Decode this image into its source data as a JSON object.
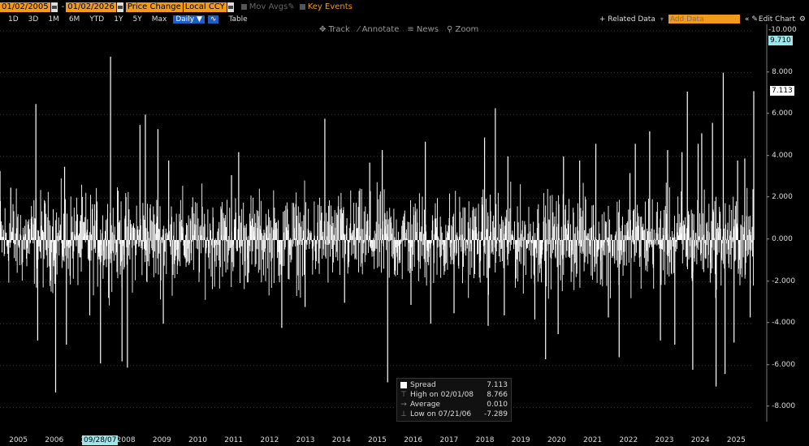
{
  "toolbar": {
    "start_date": "01/02/2005",
    "end_date": "01/02/2026",
    "mode": "Price Change",
    "currency": "Local CCY",
    "mov_avgs": "Mov Avgs",
    "key_events": "Key Events",
    "related_data": "+ Related Data",
    "add_data_placeholder": "Add Data",
    "edit_chart": "Edit Chart"
  },
  "ranges": [
    "1D",
    "3D",
    "1M",
    "6M",
    "YTD",
    "1Y",
    "5Y",
    "Max"
  ],
  "frequency": "Daily ▼",
  "table_label": "Table",
  "chart_tools": [
    "Track",
    "Annotate",
    "News",
    "Zoom"
  ],
  "colors": {
    "accent": "#f29a1d",
    "selected": "#1f5fbf",
    "cursor": "#9fe6ea",
    "series": "#ffffff",
    "background": "#000000"
  },
  "chart_data": {
    "type": "bar",
    "series": [
      {
        "name": "Spread"
      }
    ],
    "x_range": [
      2005,
      2026
    ],
    "ylim": [
      -8.8,
      10.0
    ],
    "yticks": [
      10,
      8,
      6,
      4,
      2,
      0,
      -2,
      -4,
      -6,
      -8
    ],
    "ytick_labels": [
      "10.000",
      "8.000",
      "6.000",
      "4.000",
      "2.000",
      "0.000",
      "-2.000",
      "-4.000",
      "-6.000",
      "-8.000"
    ],
    "years": [
      "2005",
      "2006",
      "2007",
      "2008",
      "2009",
      "2010",
      "2011",
      "2012",
      "2013",
      "2014",
      "2015",
      "2016",
      "2017",
      "2018",
      "2019",
      "2020",
      "2021",
      "2022",
      "2023",
      "2024",
      "2025"
    ],
    "last_value_label": "7.113",
    "high_marker_label": "9.710",
    "cursor_date": "09/28/07",
    "legend": {
      "series_name": "Spread",
      "last": "7.113",
      "high_label": "High on 02/01/08",
      "high_value": "8.766",
      "avg_label": "Average",
      "avg_value": "0.010",
      "low_label": "Low on 07/21/06",
      "low_value": "-7.289"
    },
    "spikes": [
      {
        "x": 2005.0,
        "y": 3.3
      },
      {
        "x": 2005.3,
        "y": 2.5
      },
      {
        "x": 2006.0,
        "y": 6.5
      },
      {
        "x": 2006.05,
        "y": -4.8
      },
      {
        "x": 2006.55,
        "y": -7.289
      },
      {
        "x": 2006.8,
        "y": 3.5
      },
      {
        "x": 2006.85,
        "y": -5.0
      },
      {
        "x": 2007.5,
        "y": -3.6
      },
      {
        "x": 2007.8,
        "y": -5.9
      },
      {
        "x": 2008.08,
        "y": 8.766
      },
      {
        "x": 2008.4,
        "y": -5.8
      },
      {
        "x": 2008.55,
        "y": -6.1
      },
      {
        "x": 2008.9,
        "y": 5.5
      },
      {
        "x": 2009.05,
        "y": 6.0
      },
      {
        "x": 2009.4,
        "y": 5.3
      },
      {
        "x": 2009.55,
        "y": -4.0
      },
      {
        "x": 2009.7,
        "y": 3.8
      },
      {
        "x": 2011.45,
        "y": 3.1
      },
      {
        "x": 2011.65,
        "y": 4.2
      },
      {
        "x": 2012.85,
        "y": -4.2
      },
      {
        "x": 2013.5,
        "y": -3.2
      },
      {
        "x": 2014.05,
        "y": 5.8
      },
      {
        "x": 2014.6,
        "y": -3.0
      },
      {
        "x": 2015.3,
        "y": 3.7
      },
      {
        "x": 2015.65,
        "y": 4.3
      },
      {
        "x": 2015.8,
        "y": -6.8
      },
      {
        "x": 2016.45,
        "y": -3.1
      },
      {
        "x": 2016.85,
        "y": 4.7
      },
      {
        "x": 2017.0,
        "y": -4.0
      },
      {
        "x": 2017.65,
        "y": -3.5
      },
      {
        "x": 2018.5,
        "y": 4.9
      },
      {
        "x": 2018.6,
        "y": -4.1
      },
      {
        "x": 2018.8,
        "y": 6.3
      },
      {
        "x": 2019.05,
        "y": -3.6
      },
      {
        "x": 2019.15,
        "y": 4.0
      },
      {
        "x": 2019.9,
        "y": -3.8
      },
      {
        "x": 2020.2,
        "y": -5.7
      },
      {
        "x": 2020.55,
        "y": -4.5
      },
      {
        "x": 2020.7,
        "y": 4.0
      },
      {
        "x": 2021.15,
        "y": 3.8
      },
      {
        "x": 2021.6,
        "y": 4.6
      },
      {
        "x": 2021.95,
        "y": -3.7
      },
      {
        "x": 2022.25,
        "y": -5.6
      },
      {
        "x": 2022.55,
        "y": 3.2
      },
      {
        "x": 2022.7,
        "y": 4.6
      },
      {
        "x": 2023.1,
        "y": 5.2
      },
      {
        "x": 2023.4,
        "y": -4.8
      },
      {
        "x": 2023.6,
        "y": 4.3
      },
      {
        "x": 2023.8,
        "y": -5.0
      },
      {
        "x": 2024.0,
        "y": 4.2
      },
      {
        "x": 2024.15,
        "y": 7.1
      },
      {
        "x": 2024.3,
        "y": -6.2
      },
      {
        "x": 2024.45,
        "y": 4.6
      },
      {
        "x": 2024.55,
        "y": 5.1
      },
      {
        "x": 2024.85,
        "y": 5.6
      },
      {
        "x": 2024.95,
        "y": -7.0
      },
      {
        "x": 2025.15,
        "y": 8.0
      },
      {
        "x": 2025.2,
        "y": -6.4
      },
      {
        "x": 2025.45,
        "y": -4.9
      },
      {
        "x": 2025.55,
        "y": 3.8
      },
      {
        "x": 2025.75,
        "y": 3.9
      },
      {
        "x": 2025.9,
        "y": -3.7
      },
      {
        "x": 2026.0,
        "y": 7.113
      }
    ]
  }
}
